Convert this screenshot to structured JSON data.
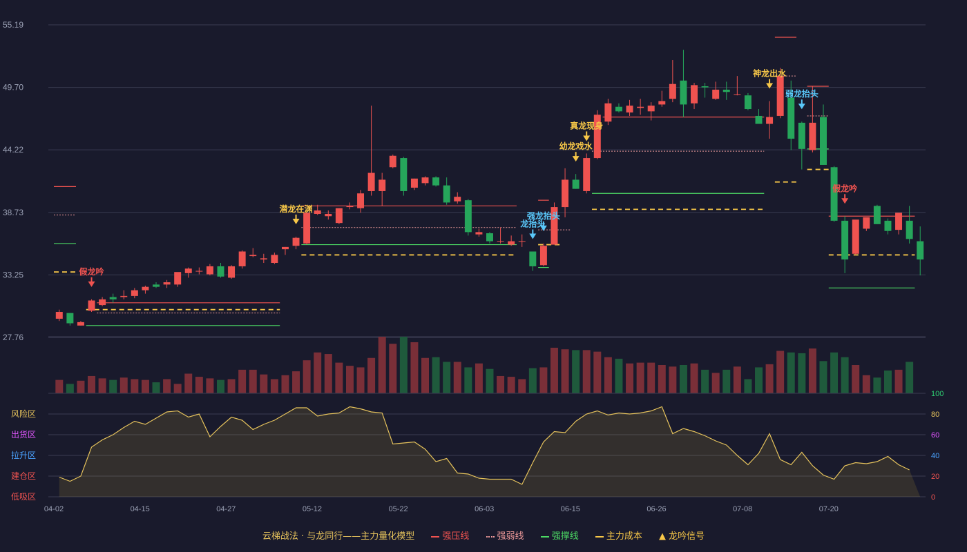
{
  "chart_data": [
    {
      "type": "candlestick",
      "title": "",
      "ylim": [
        27.76,
        55.19
      ],
      "y_ticks": [
        "55.19",
        "49.70",
        "44.22",
        "38.73",
        "33.25",
        "27.76"
      ],
      "x_ticks": [
        "04-02",
        "04-15",
        "04-27",
        "05-12",
        "05-22",
        "06-03",
        "06-15",
        "06-26",
        "07-08",
        "07-20"
      ],
      "x_tick_index": [
        0,
        8,
        16,
        24,
        32,
        40,
        48,
        56,
        64,
        72
      ],
      "ohlc": [
        [
          29.4,
          30.2,
          29.2,
          30.0
        ],
        [
          29.9,
          29.9,
          28.8,
          29.0
        ],
        [
          28.8,
          29.2,
          28.8,
          29.1
        ],
        [
          30.1,
          31.1,
          30.0,
          31.0
        ],
        [
          30.6,
          31.3,
          30.5,
          31.1
        ],
        [
          31.3,
          31.6,
          30.8,
          31.1
        ],
        [
          31.3,
          31.9,
          31.1,
          31.4
        ],
        [
          31.4,
          32.1,
          31.2,
          31.9
        ],
        [
          31.9,
          32.3,
          31.6,
          32.2
        ],
        [
          32.4,
          32.6,
          32.1,
          32.2
        ],
        [
          32.4,
          32.8,
          32.1,
          32.6
        ],
        [
          32.4,
          33.4,
          32.2,
          33.5
        ],
        [
          33.4,
          33.9,
          33.0,
          33.8
        ],
        [
          33.6,
          33.9,
          33.3,
          33.6
        ],
        [
          33.3,
          34.2,
          33.2,
          34.0
        ],
        [
          34.0,
          34.3,
          33.0,
          33.1
        ],
        [
          33.0,
          34.1,
          32.9,
          34.0
        ],
        [
          34.0,
          35.4,
          33.8,
          35.3
        ],
        [
          34.9,
          35.6,
          34.8,
          35.0
        ],
        [
          34.6,
          35.1,
          34.3,
          34.7
        ],
        [
          34.3,
          35.2,
          34.2,
          35.0
        ],
        [
          35.5,
          35.7,
          35.0,
          35.7
        ],
        [
          35.8,
          36.6,
          35.5,
          36.5
        ],
        [
          36.0,
          38.8,
          35.9,
          38.7
        ],
        [
          38.6,
          39.4,
          38.5,
          38.9
        ],
        [
          38.4,
          38.9,
          38.1,
          38.6
        ],
        [
          37.8,
          39.1,
          37.7,
          39.1
        ],
        [
          39.2,
          39.6,
          39.0,
          39.3
        ],
        [
          39.1,
          40.7,
          38.7,
          40.4
        ],
        [
          40.6,
          48.1,
          40.2,
          42.2
        ],
        [
          40.6,
          42.2,
          39.3,
          41.6
        ],
        [
          42.7,
          43.8,
          42.6,
          43.7
        ],
        [
          43.5,
          43.6,
          40.2,
          40.6
        ],
        [
          40.9,
          41.7,
          40.7,
          41.7
        ],
        [
          41.3,
          41.9,
          41.1,
          41.8
        ],
        [
          41.8,
          41.9,
          41.0,
          41.1
        ],
        [
          41.1,
          41.8,
          39.4,
          39.6
        ],
        [
          39.7,
          40.5,
          39.5,
          40.1
        ],
        [
          39.8,
          39.9,
          36.7,
          37.0
        ],
        [
          36.8,
          37.3,
          36.6,
          37.0
        ],
        [
          36.9,
          37.0,
          36.0,
          36.2
        ],
        [
          36.2,
          37.4,
          36.0,
          36.2
        ],
        [
          35.9,
          36.7,
          35.8,
          36.2
        ],
        [
          36.2,
          36.8,
          35.7,
          36.2
        ],
        [
          35.3,
          35.3,
          33.6,
          34.0
        ],
        [
          34.1,
          36.0,
          34.0,
          35.8
        ],
        [
          35.9,
          39.6,
          35.9,
          39.2
        ],
        [
          39.2,
          42.6,
          38.3,
          41.6
        ],
        [
          41.6,
          42.1,
          40.8,
          40.8
        ],
        [
          40.6,
          43.9,
          40.4,
          43.5
        ],
        [
          43.5,
          47.7,
          43.4,
          47.3
        ],
        [
          46.7,
          48.7,
          46.4,
          48.3
        ],
        [
          48.0,
          48.3,
          47.5,
          47.6
        ],
        [
          47.5,
          48.6,
          47.2,
          48.1
        ],
        [
          47.9,
          48.7,
          47.3,
          48.0
        ],
        [
          47.6,
          48.4,
          46.8,
          48.1
        ],
        [
          48.2,
          49.4,
          48.0,
          48.5
        ],
        [
          48.7,
          52.1,
          48.4,
          50.0
        ],
        [
          50.3,
          53.0,
          47.1,
          48.2
        ],
        [
          48.3,
          50.1,
          47.8,
          49.9
        ],
        [
          49.8,
          50.1,
          48.8,
          49.7
        ],
        [
          48.7,
          50.2,
          48.6,
          49.5
        ],
        [
          49.5,
          50.2,
          48.6,
          49.3
        ],
        [
          49.1,
          50.7,
          49.0,
          49.1
        ],
        [
          49.0,
          49.2,
          47.7,
          47.8
        ],
        [
          47.2,
          47.8,
          46.6,
          46.5
        ],
        [
          46.5,
          48.5,
          45.2,
          47.1
        ],
        [
          47.2,
          51.4,
          47.0,
          50.7
        ],
        [
          48.8,
          50.3,
          44.2,
          45.2
        ],
        [
          46.6,
          46.7,
          42.5,
          44.3
        ],
        [
          44.2,
          49.8,
          44.0,
          46.6
        ],
        [
          47.1,
          48.2,
          42.9,
          42.9
        ],
        [
          42.7,
          42.8,
          37.9,
          38.0
        ],
        [
          38.0,
          38.4,
          33.4,
          34.6
        ],
        [
          35.1,
          36.9,
          35.0,
          38.1
        ],
        [
          37.3,
          38.2,
          37.1,
          38.3
        ],
        [
          39.3,
          39.4,
          37.7,
          37.7
        ],
        [
          38.0,
          38.2,
          36.8,
          37.1
        ],
        [
          37.2,
          38.5,
          36.8,
          38.7
        ],
        [
          38.0,
          39.3,
          36.0,
          36.4
        ],
        [
          36.2,
          37.5,
          33.2,
          34.6
        ]
      ],
      "lines": {
        "strong_resistance": [
          [
            4,
            21,
            30.8
          ],
          [
            23,
            43,
            39.3
          ],
          [
            45,
            46,
            39.8
          ],
          [
            51,
            66,
            47.1
          ],
          [
            67,
            69,
            54.1
          ],
          [
            70,
            72,
            49.8
          ],
          [
            72,
            80,
            38.4
          ]
        ],
        "weak_resistance": [
          [
            4,
            21,
            29.9
          ],
          [
            23,
            43,
            37.4
          ],
          [
            45,
            48,
            37.2
          ],
          [
            50,
            66,
            44.1
          ],
          [
            67,
            69,
            50.7
          ],
          [
            70,
            72,
            47.2
          ]
        ],
        "strong_support": [
          [
            3,
            21,
            28.8
          ],
          [
            23,
            43,
            35.9
          ],
          [
            45,
            46,
            33.9
          ],
          [
            50,
            66,
            40.4
          ],
          [
            70,
            72,
            44.3
          ],
          [
            72,
            80,
            32.1
          ]
        ],
        "main_cost": [
          [
            3,
            21,
            30.2
          ],
          [
            23,
            43,
            35.0
          ],
          [
            45,
            47,
            35.9
          ],
          [
            50,
            66,
            39.0
          ],
          [
            67,
            69,
            41.4
          ],
          [
            70,
            72,
            42.5
          ],
          [
            72,
            80,
            35.0
          ]
        ],
        "left_markers": {
          "strong_resistance": 41.0,
          "weak_resistance": 38.5,
          "strong_support": 36.0,
          "main_cost": 33.5
        }
      },
      "signals": [
        {
          "index": 3,
          "label": "假龙吟",
          "color": "#ef5350",
          "kind": "arrow"
        },
        {
          "index": 22,
          "label": "潜龙在渊",
          "color": "#f7c748",
          "kind": "arrow"
        },
        {
          "index": 44,
          "label": "龙抬头",
          "color": "#5ac8fa",
          "kind": "arrow"
        },
        {
          "index": 45,
          "label": "强龙抬头",
          "color": "#5ac8fa",
          "kind": "arrow"
        },
        {
          "index": 48,
          "label": "幼龙戏水",
          "color": "#f7c748",
          "kind": "arrow"
        },
        {
          "index": 49,
          "label": "真龙现身",
          "color": "#f7c748",
          "kind": "arrow"
        },
        {
          "index": 66,
          "label": "神龙出水",
          "color": "#f7c748",
          "kind": "arrow"
        },
        {
          "index": 69,
          "label": "弱龙抬头",
          "color": "#5ac8fa",
          "kind": "arrow"
        },
        {
          "index": 73,
          "label": "假龙吟",
          "color": "#ef5350",
          "kind": "arrow"
        }
      ]
    },
    {
      "type": "bar",
      "title": "",
      "volume": [
        17,
        12,
        16,
        22,
        19,
        17,
        20,
        18,
        17,
        14,
        18,
        12,
        25,
        21,
        19,
        17,
        18,
        30,
        30,
        24,
        18,
        23,
        28,
        42,
        52,
        50,
        39,
        35,
        33,
        45,
        72,
        63,
        72,
        65,
        45,
        46,
        40,
        40,
        33,
        38,
        31,
        22,
        21,
        18,
        32,
        33,
        58,
        56,
        55,
        55,
        53,
        46,
        44,
        38,
        39,
        39,
        36,
        34,
        36,
        38,
        30,
        26,
        30,
        34,
        18,
        33,
        37,
        54,
        52,
        51,
        57,
        41,
        52,
        46,
        36,
        23,
        20,
        29,
        30,
        40
      ],
      "volume_colors_note": "red when close>=open, green otherwise"
    },
    {
      "type": "area",
      "title": "",
      "ylim": [
        0,
        100
      ],
      "right_ticks": [
        "100",
        "80",
        "60",
        "40",
        "20",
        "0"
      ],
      "right_tick_colors": [
        "#2ecc71",
        "#e6c35c",
        "#e056fd",
        "#4aa3ff",
        "#ef5350",
        "#ef5350"
      ],
      "left_zones": [
        "风险区",
        "出货区",
        "拉升区",
        "建仓区",
        "低吸区"
      ],
      "left_zone_colors": [
        "#e6c35c",
        "#e056fd",
        "#4aa3ff",
        "#ef5350",
        "#ef5350"
      ],
      "values": [
        19,
        15,
        20,
        48,
        55,
        60,
        67,
        73,
        70,
        76,
        82,
        83,
        77,
        80,
        58,
        68,
        77,
        74,
        65,
        70,
        74,
        80,
        86,
        86,
        78,
        80,
        81,
        87,
        85,
        82,
        81,
        51,
        52,
        53,
        46,
        34,
        37,
        23,
        22,
        18,
        17,
        17,
        17,
        12,
        33,
        53,
        63,
        62,
        73,
        80,
        83,
        79,
        81,
        80,
        81,
        83,
        87,
        61,
        66,
        63,
        59,
        54,
        50,
        40,
        31,
        42,
        61,
        36,
        31,
        43,
        30,
        21,
        17,
        30,
        33,
        32,
        34,
        39,
        31,
        26
      ]
    }
  ],
  "legend": {
    "title": "云梯战法 · 与龙同行——主力量化模型",
    "items": [
      {
        "label": "强压线",
        "color": "#ef5350",
        "style": "solid"
      },
      {
        "label": "强弱线",
        "color": "#ef9a9a",
        "style": "dotted"
      },
      {
        "label": "强撑线",
        "color": "#4cd964",
        "style": "solid"
      },
      {
        "label": "主力成本",
        "color": "#f7c748",
        "style": "dashed"
      },
      {
        "label": "龙吟信号",
        "color": "#f7c748",
        "style": "triangle"
      }
    ]
  },
  "colors": {
    "up": "#ef5350",
    "down": "#26a65b",
    "grid": "#3a3c52",
    "axis_text": "#9aa0b4",
    "bg": "#191a2c"
  }
}
